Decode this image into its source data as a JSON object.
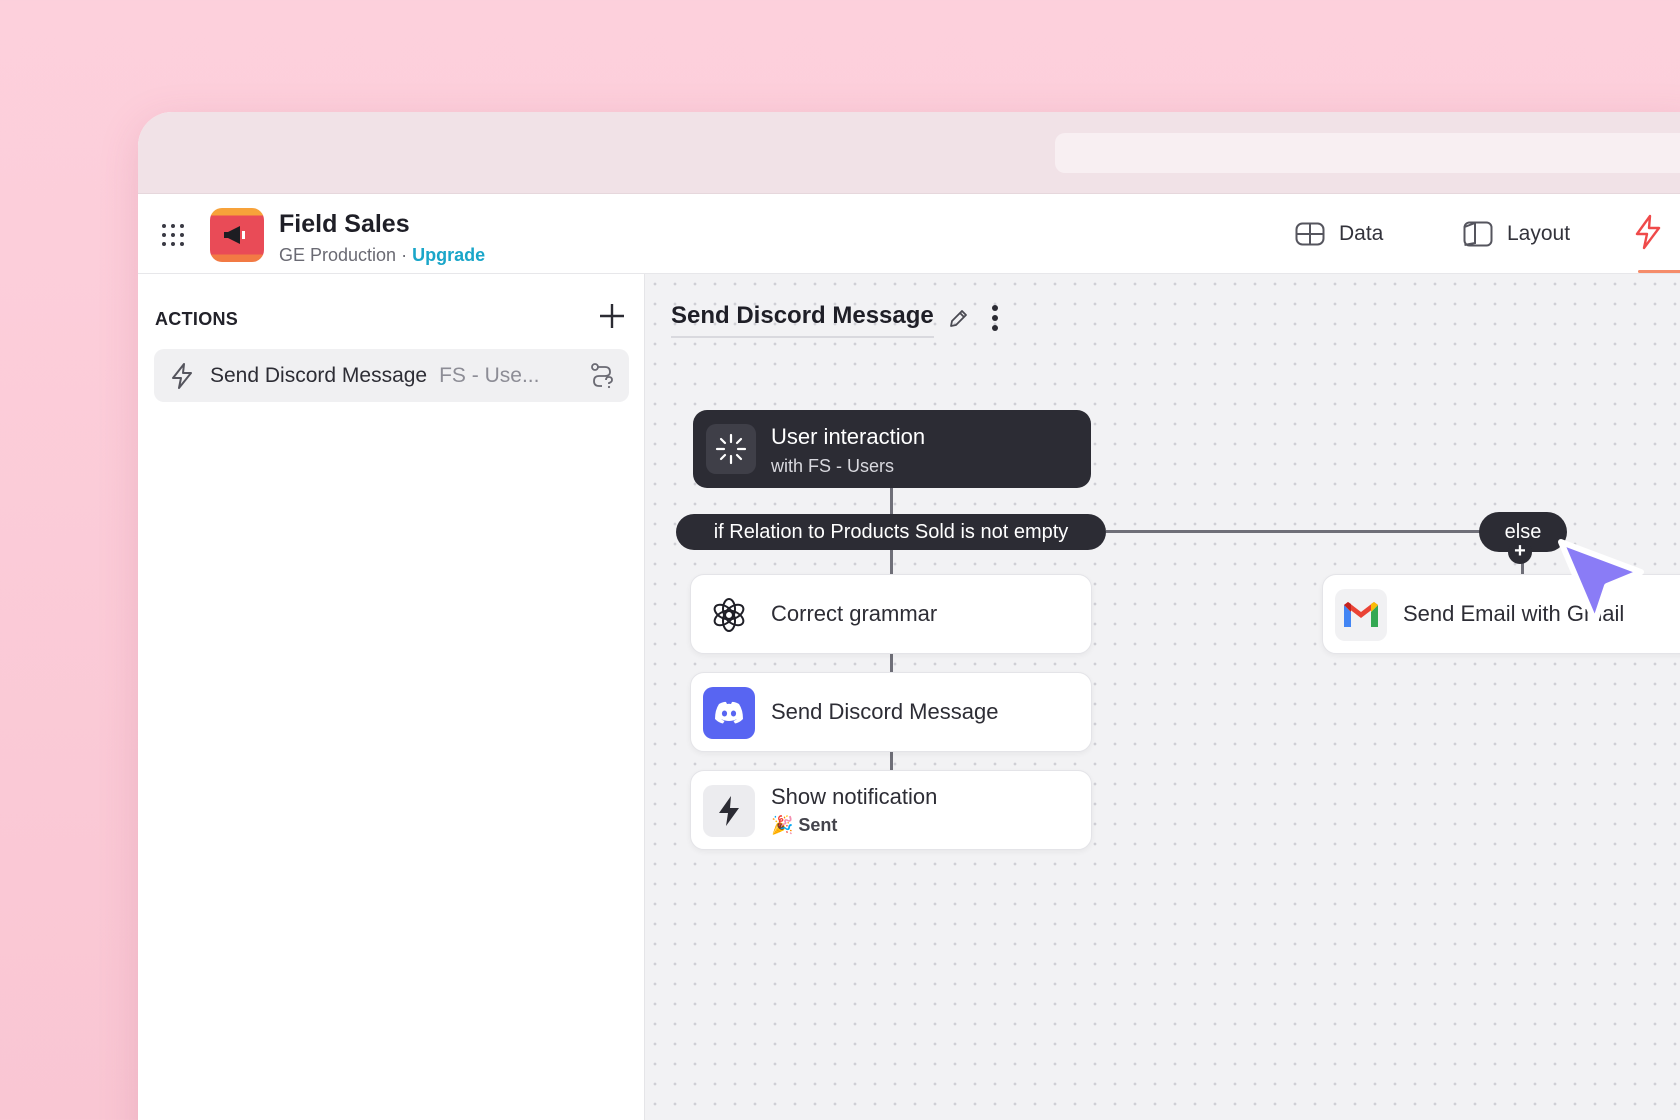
{
  "app": {
    "name": "Field Sales",
    "environment": "GE Production",
    "separator": "·",
    "upgrade_label": "Upgrade"
  },
  "nav": {
    "data_label": "Data",
    "layout_label": "Layout"
  },
  "sidebar": {
    "title": "ACTIONS",
    "actions": [
      {
        "name": "Send Discord Message",
        "table": "FS - Use..."
      }
    ]
  },
  "workflow": {
    "title": "Send Discord Message",
    "trigger": {
      "title": "User interaction",
      "subtitle": "with FS - Users"
    },
    "condition": "if Relation to Products Sold is not empty",
    "else_label": "else",
    "steps": [
      {
        "label": "Correct grammar",
        "icon": "openai-icon"
      },
      {
        "label": "Send Discord Message",
        "icon": "discord-icon"
      },
      {
        "label": "Show notification",
        "icon": "bolt-icon",
        "detail": "🎉 Sent"
      }
    ],
    "else_steps": [
      {
        "label": "Send Email with Gmail",
        "icon": "gmail-icon"
      }
    ]
  },
  "colors": {
    "background": "#fdd0dc",
    "dark_node": "#2c2c34",
    "discord": "#5865f2",
    "accent_link": "#1aa6c9",
    "cursor": "#8a7cf6"
  }
}
